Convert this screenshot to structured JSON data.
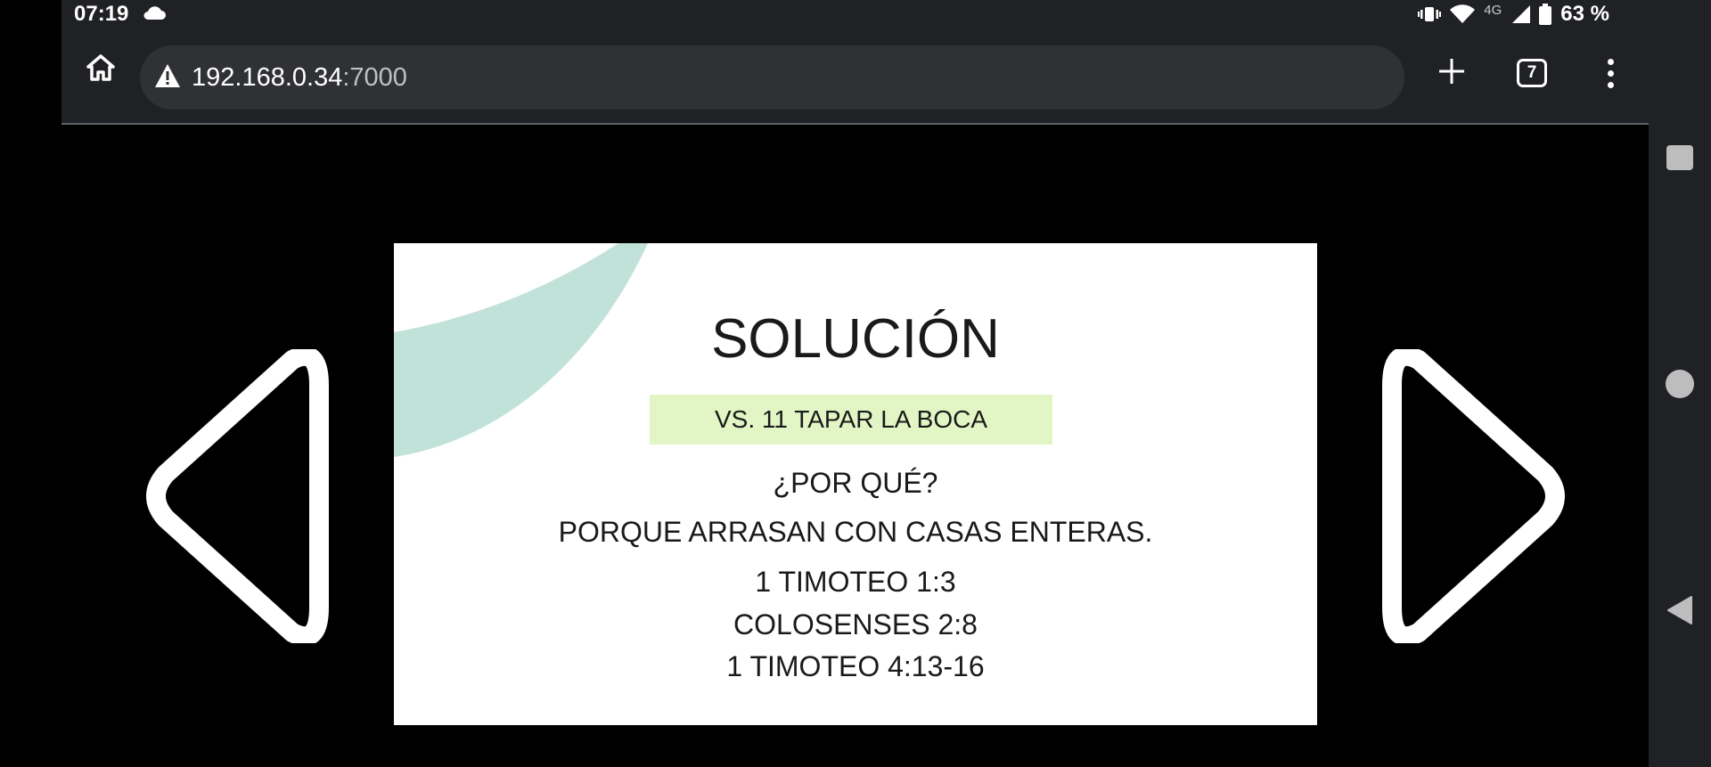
{
  "status_bar": {
    "time": "07:19",
    "network_label": "4G",
    "battery_text": "63 %"
  },
  "browser": {
    "url_host": "192.168.0.34",
    "url_port": ":7000",
    "tab_count": "7"
  },
  "slide": {
    "title": "SOLUCIÓN",
    "subtitle": "VS. 11 TAPAR LA BOCA",
    "lines": [
      "¿POR QUÉ?",
      "PORQUE ARRASAN CON CASAS ENTERAS.",
      "1 TIMOTEO 1:3",
      "COLOSENSES 2:8",
      "1 TIMOTEO 4:13-16"
    ],
    "subtitle_color": "#e2f5c4",
    "decor_color": "#c1e2d8"
  },
  "icons": {
    "home": "home-icon",
    "warning": "warning-icon",
    "new_tab": "plus-icon",
    "tabs": "tab-switcher-icon",
    "menu": "more-vert-icon",
    "prev": "triangle-left-icon",
    "next": "triangle-right-icon"
  }
}
